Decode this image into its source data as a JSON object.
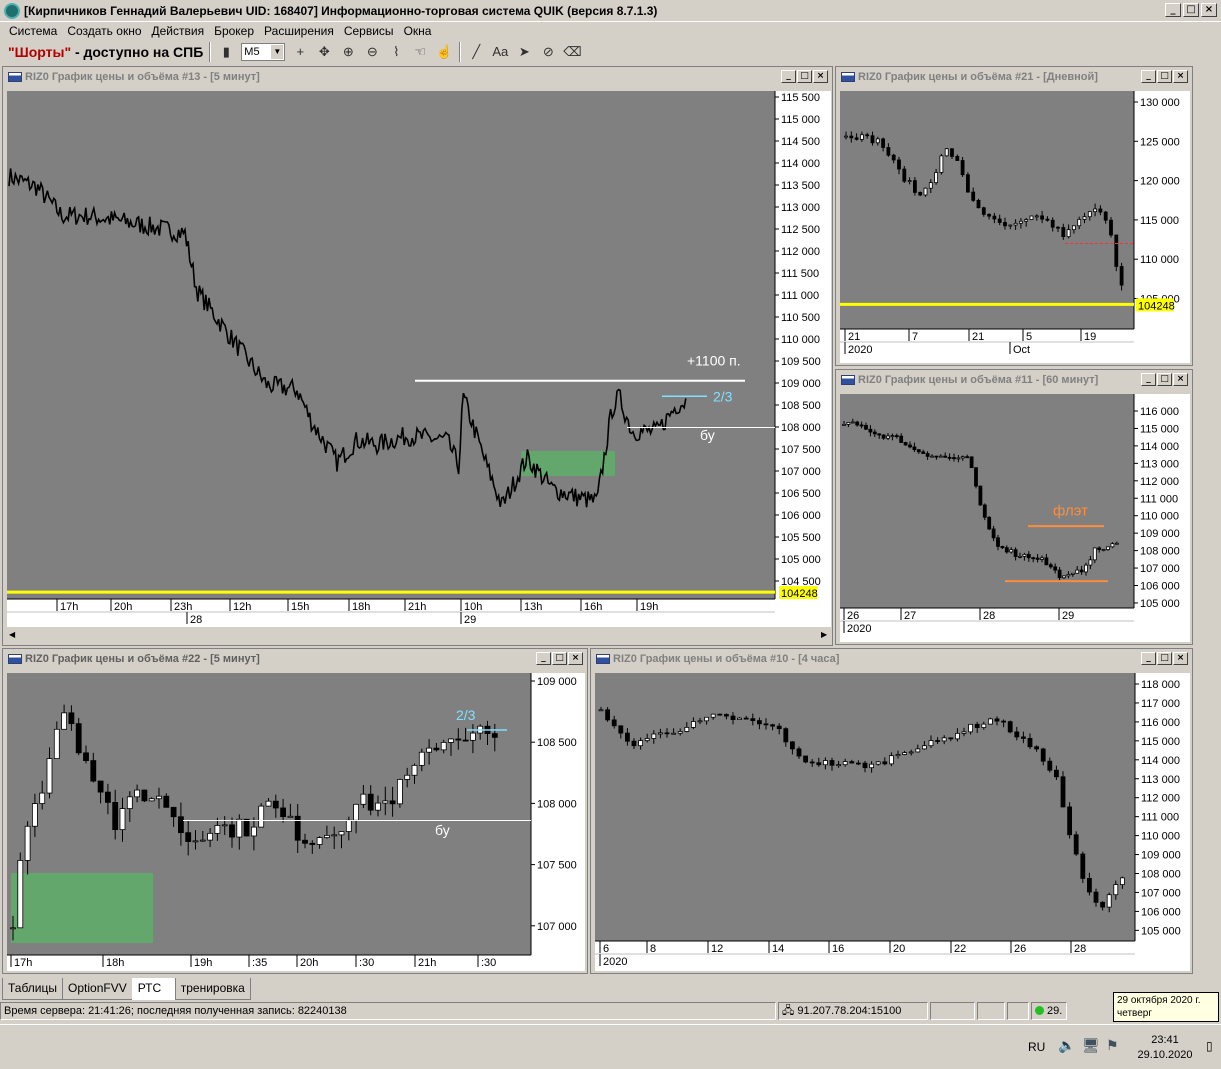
{
  "window": {
    "title": "[Кирпичников Геннадий Валерьевич UID: 168407] Информационно-торговая система QUIK (версия 8.7.1.3)"
  },
  "menu": [
    "Система",
    "Создать окно",
    "Действия",
    "Брокер",
    "Расширения",
    "Сервисы",
    "Окна"
  ],
  "toolbar": {
    "shorts_quoted": "\"Шорты\"",
    "shorts_rest": " - доступно на СПБ",
    "interval_value": "M5",
    "font_label": "Aa"
  },
  "chart13": {
    "title": "RIZ0 График цены и объёма #13 - [5 минут]",
    "yticks": [
      "115 500",
      "115 000",
      "114 500",
      "114 000",
      "113 500",
      "113 000",
      "112 500",
      "112 000",
      "111 500",
      "111 000",
      "110 500",
      "110 000",
      "109 500",
      "109 000",
      "108 500",
      "108 000",
      "107 500",
      "107 000",
      "106 500",
      "106 000",
      "105 500",
      "105 000",
      "104 500"
    ],
    "price_label": "104248",
    "annotations": {
      "plus": "+1100 п.",
      "two_thirds": "2/3",
      "bu": "бу"
    },
    "xticks": [
      "17h",
      "20h",
      "23h",
      "12h",
      "15h",
      "18h",
      "21h",
      "10h",
      "13h",
      "16h",
      "19h"
    ],
    "dates": [
      "28",
      "29"
    ]
  },
  "chart21": {
    "title": "RIZ0 График цены и объёма #21 - [Дневной]",
    "yticks": [
      "130 000",
      "125 000",
      "120 000",
      "115 000",
      "110 000",
      "105 000"
    ],
    "price_label": "104248",
    "xticks": [
      "21",
      "7",
      "21",
      "5",
      "19"
    ],
    "dates": [
      "2020",
      "Oct"
    ]
  },
  "chart11": {
    "title": "RIZ0 График цены и объёма #11 - [60 минут]",
    "yticks": [
      "116 000",
      "115 000",
      "114 000",
      "113 000",
      "112 000",
      "111 000",
      "110 000",
      "109 000",
      "108 000",
      "107 000",
      "106 000",
      "105 000"
    ],
    "annotation": "флэт",
    "xticks": [
      "26",
      "27",
      "28",
      "29"
    ],
    "dates": [
      "2020"
    ]
  },
  "chart22": {
    "title": "RIZ0 График цены и объёма #22 - [5 минут]",
    "yticks": [
      "109 000",
      "108 500",
      "108 000",
      "107 500",
      "107 000"
    ],
    "annotations": {
      "two_thirds": "2/3",
      "bu": "бу"
    },
    "xticks": [
      "17h",
      "18h",
      "19h",
      ":35",
      "20h",
      ":30",
      "21h",
      ":30"
    ]
  },
  "chart10": {
    "title": "RIZ0 График цены и объёма #10 - [4 часа]",
    "yticks": [
      "118 000",
      "117 000",
      "116 000",
      "115 000",
      "114 000",
      "113 000",
      "112 000",
      "111 000",
      "110 000",
      "109 000",
      "108 000",
      "107 000",
      "106 000",
      "105 000"
    ],
    "xticks": [
      "6",
      "8",
      "12",
      "14",
      "16",
      "20",
      "22",
      "26",
      "28"
    ],
    "dates": [
      "2020"
    ]
  },
  "tabs": [
    "Таблицы",
    "OptionFVV",
    "РТС",
    "тренировка"
  ],
  "status": {
    "server": "Время сервера: 21:41:26; последняя полученная запись: 82240138",
    "connection": "91.207.78.204:15100",
    "date_short": "29."
  },
  "tooltip": {
    "line1": "29 октября 2020 г.",
    "line2": "четверг"
  },
  "taskbar": {
    "lang": "RU",
    "time": "23:41",
    "date": "29.10.2020"
  },
  "colors": {
    "plot_bg": "#808080",
    "yellow_line": "#ffff00",
    "cyan": "#7fe0ff",
    "orange": "#ff8c3a",
    "green_box": "#5fae6a"
  }
}
